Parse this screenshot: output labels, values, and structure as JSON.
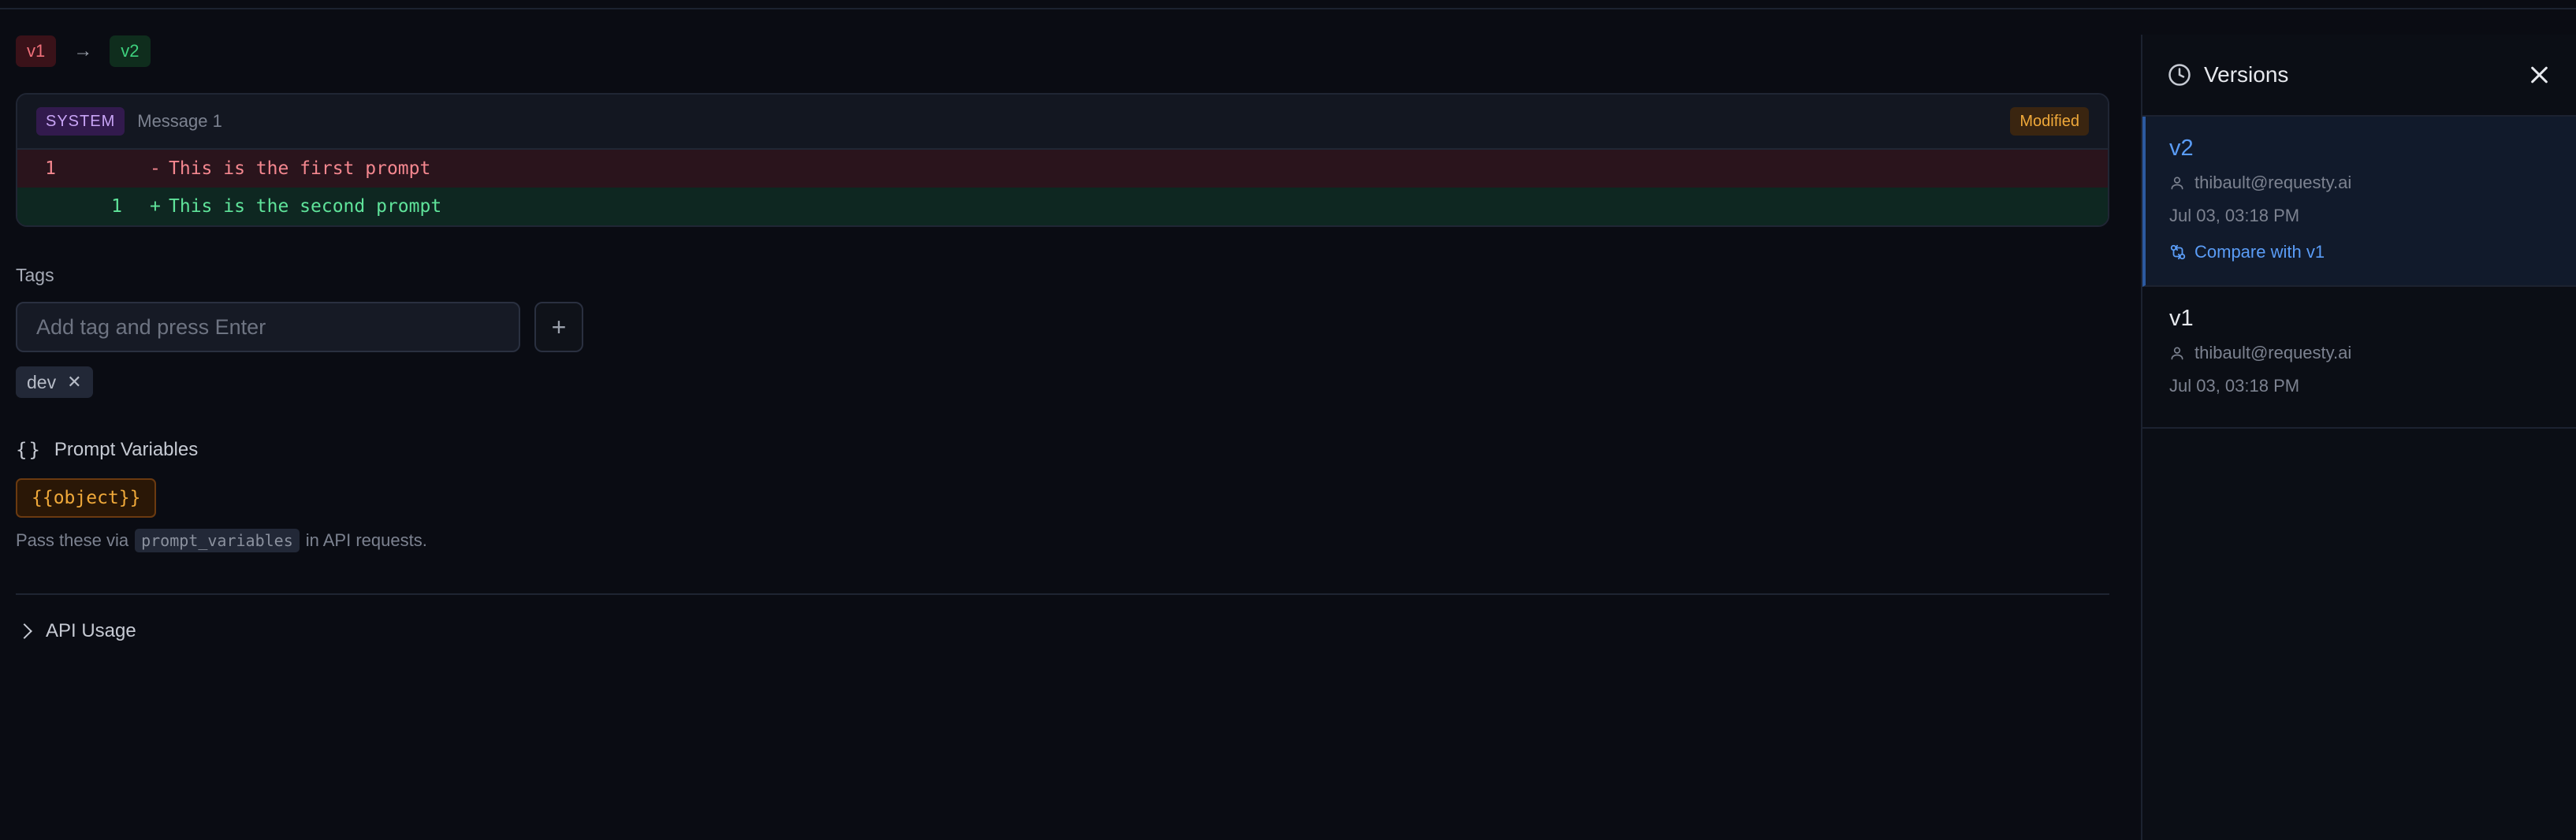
{
  "diff": {
    "from_version": "v1",
    "arrow": "→",
    "to_version": "v2",
    "role": "SYSTEM",
    "message_label": "Message 1",
    "status": "Modified",
    "removed": {
      "line": "1",
      "sign": "-",
      "text": "This is the first prompt"
    },
    "added": {
      "line": "1",
      "sign": "+",
      "text": "This is the second prompt"
    }
  },
  "tags": {
    "label": "Tags",
    "input_placeholder": "Add tag and press Enter",
    "add_button": "+",
    "items": [
      {
        "label": "dev",
        "remove": "✕"
      }
    ]
  },
  "variables": {
    "braces": "{}",
    "title": "Prompt Variables",
    "items": [
      "{{object}}"
    ],
    "help_prefix": "Pass these via",
    "help_code": "prompt_variables",
    "help_suffix": "in API requests."
  },
  "api_usage": {
    "label": "API Usage"
  },
  "versions_panel": {
    "title": "Versions",
    "items": [
      {
        "name": "v2",
        "author": "thibault@requesty.ai",
        "date": "Jul 03, 03:18 PM",
        "compare": "Compare with v1"
      },
      {
        "name": "v1",
        "author": "thibault@requesty.ai",
        "date": "Jul 03, 03:18 PM"
      }
    ]
  },
  "colors": {
    "accent": "#5a9cf6",
    "removed": "#f4878f",
    "added": "#5fe39a",
    "warning": "#f0a93a",
    "background": "#0a0c13"
  }
}
